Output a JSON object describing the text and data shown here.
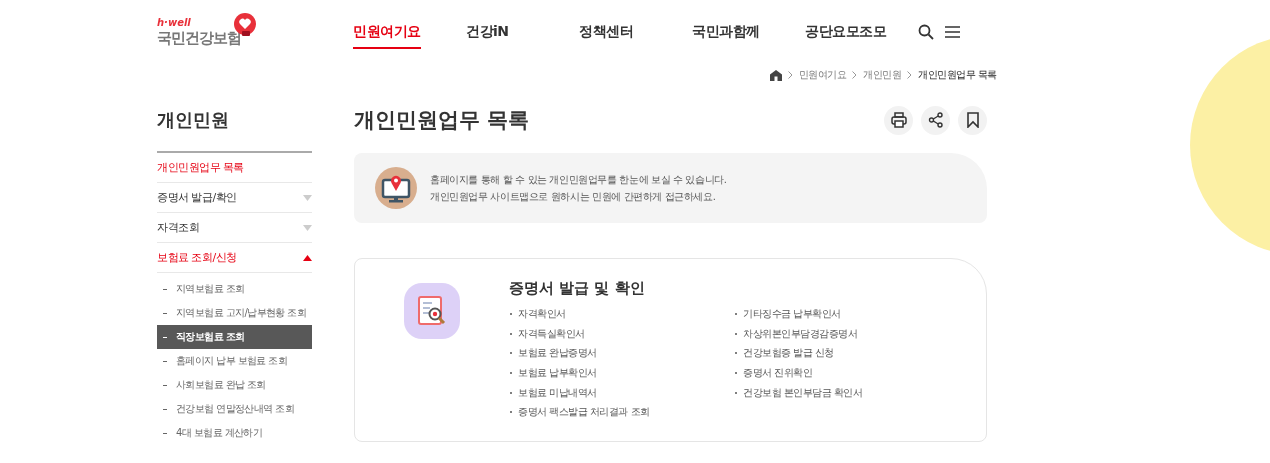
{
  "logo": {
    "tagline": "h·well",
    "name": "국민건강보험"
  },
  "nav": [
    {
      "label": "민원여기요",
      "selected": true
    },
    {
      "label": "건강iN",
      "selected": false
    },
    {
      "label": "정책센터",
      "selected": false
    },
    {
      "label": "국민과함께",
      "selected": false
    },
    {
      "label": "공단요모조모",
      "selected": false
    }
  ],
  "breadcrumb": [
    "민원여기요",
    "개인민원",
    "개인민원업무 목록"
  ],
  "sidebar": {
    "title": "개인민원",
    "items": [
      {
        "label": "개인민원업무 목록",
        "kind": "link",
        "selected": true
      },
      {
        "label": "증명서 발급/확인",
        "kind": "group",
        "selected": false,
        "expanded": false
      },
      {
        "label": "자격조회",
        "kind": "group",
        "selected": false,
        "expanded": false
      },
      {
        "label": "보험료 조회/신청",
        "kind": "group",
        "selected": true,
        "expanded": true,
        "children": [
          {
            "label": "지역보험료 조회",
            "selected": false
          },
          {
            "label": "지역보험료 고지/납부현황 조회",
            "selected": false
          },
          {
            "label": "직장보험료 조회",
            "selected": true
          },
          {
            "label": "홈페이지 납부 보험료 조회",
            "selected": false
          },
          {
            "label": "사회보험료 완납 조회",
            "selected": false
          },
          {
            "label": "건강보험 연말정산내역 조회",
            "selected": false
          },
          {
            "label": "4대 보험료 계산하기",
            "selected": false
          }
        ]
      }
    ]
  },
  "page_title": "개인민원업무 목록",
  "intro": [
    "홈페이지를 통해 할 수 있는 개인민원업무를 한눈에 보실 수 있습니다.",
    "개인민원업무 사이트맵으로 원하시는 민원에 간편하게 접근하세요."
  ],
  "section": {
    "title": "증명서 발급 및 확인",
    "columns": [
      [
        "자격확인서",
        "자격득실확인서",
        "보험료 완납증명서",
        "보험료 납부확인서",
        "보험료 미납내역서",
        "증명서 팩스발급 처리결과 조회"
      ],
      [
        "기타징수금 납부확인서",
        "차상위본인부담경감증명서",
        "건강보험증 발급 신청",
        "증명서 진위확인",
        "건강보험 본인부담금 확인서"
      ]
    ]
  }
}
